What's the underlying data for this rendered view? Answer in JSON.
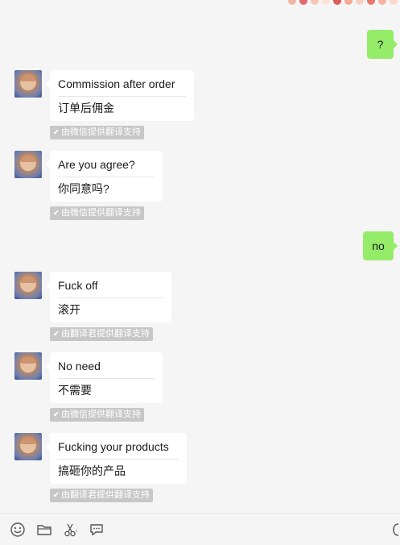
{
  "sent": {
    "question_mark": "?",
    "no": "no"
  },
  "messages": [
    {
      "original": "Commission after order",
      "translation": "订单后佣金",
      "credit": "由微信提供翻译支持"
    },
    {
      "original": "Are you agree?",
      "translation": "你同意吗?",
      "credit": "由微信提供翻译支持"
    },
    {
      "original": "Fuck off",
      "translation": "滚开",
      "credit": "由翻译君提供翻译支持"
    },
    {
      "original": "No need",
      "translation": "不需要",
      "credit": "由微信提供翻译支持"
    },
    {
      "original": "Fucking your products",
      "translation": "搞砸你的产品",
      "credit": "由翻译君提供翻译支持"
    }
  ],
  "toolbar": {
    "icons": [
      "emoji-icon",
      "folder-icon",
      "scissors-icon",
      "chat-bubble-icon",
      "phone-icon"
    ]
  },
  "colors": {
    "sent_bubble": "#95ec69",
    "received_bubble": "#ffffff",
    "background": "#f5f5f5",
    "credit_badge": "#c7c7c7"
  }
}
